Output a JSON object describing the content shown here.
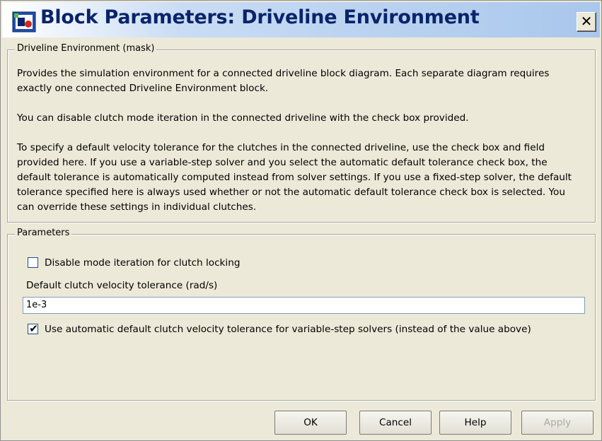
{
  "window": {
    "title": "Block Parameters: Driveline Environment",
    "close_glyph": "✕"
  },
  "description_group": {
    "label": "Driveline Environment (mask)",
    "paragraphs": [
      "Provides the simulation environment for a connected driveline block diagram. Each separate diagram requires exactly one connected Driveline Environment block.",
      "You can disable clutch mode iteration in the connected driveline with the check box provided.",
      "To specify a default velocity tolerance for the clutches in the connected driveline, use the check box and field provided here. If you use a variable-step solver and you select the automatic default tolerance check box, the default tolerance is automatically computed instead from solver settings. If you use a fixed-step solver, the default tolerance specified here is always used whether or not the automatic default tolerance check box is selected. You can override these settings in individual clutches."
    ]
  },
  "parameters_group": {
    "label": "Parameters",
    "disable_mode_iteration": {
      "label": "Disable mode iteration for clutch locking",
      "checked": false
    },
    "velocity_tolerance": {
      "label": "Default clutch velocity tolerance (rad/s)",
      "value": "1e-3"
    },
    "automatic_tolerance": {
      "label": "Use automatic default clutch velocity tolerance for variable-step solvers (instead of the value above)",
      "checked": true,
      "check_glyph": "✔"
    }
  },
  "buttons": {
    "ok": "OK",
    "cancel": "Cancel",
    "help": "Help",
    "apply": "Apply"
  },
  "icons": {
    "app_icon": "simulink-block-icon",
    "close_icon": "close-icon"
  }
}
